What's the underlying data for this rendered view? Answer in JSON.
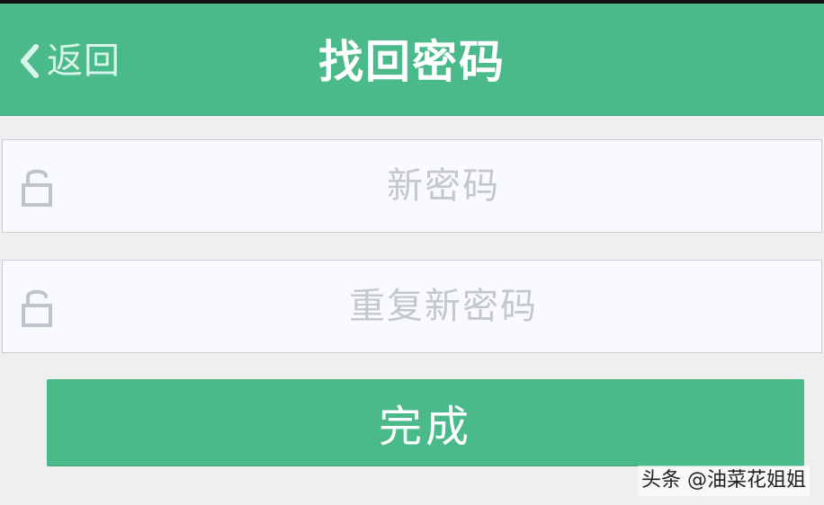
{
  "header": {
    "back_label": "返回",
    "title": "找回密码"
  },
  "form": {
    "new_password": {
      "placeholder": "新密码",
      "value": ""
    },
    "confirm_password": {
      "placeholder": "重复新密码",
      "value": ""
    },
    "submit_label": "完成"
  },
  "watermark": "头条 @油菜花姐姐",
  "icons": {
    "back": "chevron-left-icon",
    "lock": "lock-icon"
  },
  "colors": {
    "brand": "#4aba8a",
    "field_background": "#f8fafd",
    "placeholder": "#c4c7cc",
    "page_background": "#efefef"
  }
}
